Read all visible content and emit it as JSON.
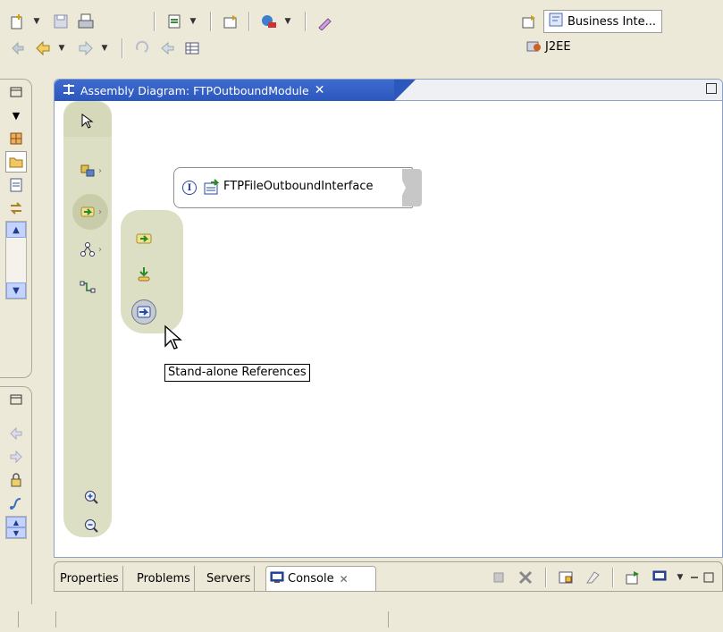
{
  "perspectives": {
    "active_label": "Business Inte...",
    "other_label": "J2EE"
  },
  "editor": {
    "tab_title": "Assembly Diagram: FTPOutboundModule",
    "close_glyph": "✕"
  },
  "diagram": {
    "node_badge": "I",
    "node_label": "FTPFileOutboundInterface"
  },
  "tooltip": "Stand-alone References",
  "views": {
    "tabs": [
      {
        "label": "Properties"
      },
      {
        "label": "Problems"
      },
      {
        "label": "Servers"
      },
      {
        "label": "Console",
        "close": "✕"
      }
    ]
  },
  "colors": {
    "editor_tab": "#2c57bd",
    "palette_bg": "#dcdfc4",
    "window_bg": "#ece9d8"
  }
}
